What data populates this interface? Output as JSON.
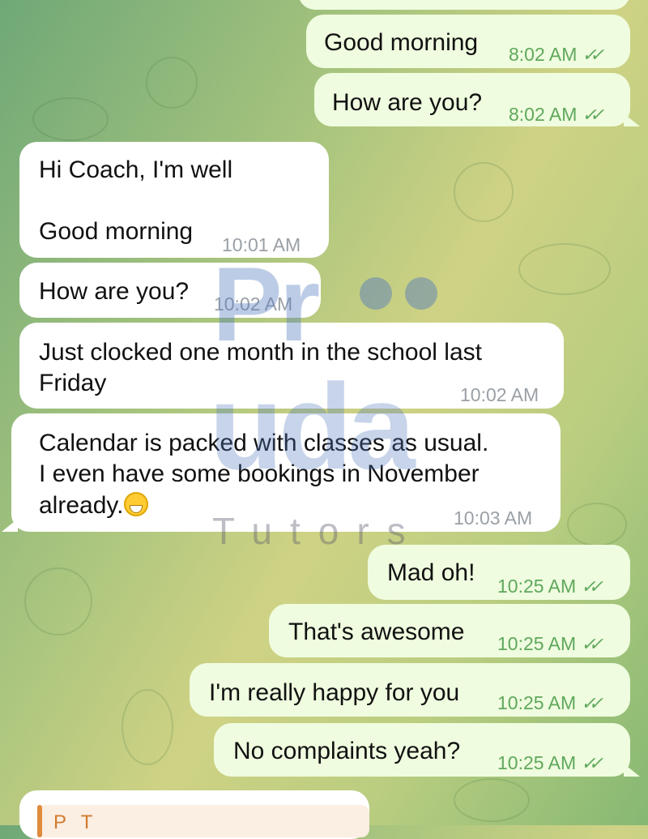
{
  "chat": {
    "messages": [
      {
        "id": "m1",
        "direction": "outgoing",
        "lines": [
          "Good morning"
        ],
        "time": "8:02 AM",
        "read": true
      },
      {
        "id": "m2",
        "direction": "outgoing",
        "lines": [
          "How are you?"
        ],
        "time": "8:02 AM",
        "read": true
      },
      {
        "id": "m3",
        "direction": "incoming",
        "lines": [
          "Hi Coach, I'm well",
          "",
          "Good morning"
        ],
        "time": "10:01 AM"
      },
      {
        "id": "m4",
        "direction": "incoming",
        "lines": [
          "How are you?"
        ],
        "time": "10:02 AM"
      },
      {
        "id": "m5",
        "direction": "incoming",
        "lines": [
          "Just clocked one month in the school last",
          "Friday"
        ],
        "time": "10:02 AM"
      },
      {
        "id": "m6",
        "direction": "incoming",
        "lines": [
          "Calendar is packed with classes as usual.",
          "I even have some bookings in November",
          "already."
        ],
        "emoji": "grinning-face",
        "time": "10:03 AM"
      },
      {
        "id": "m7",
        "direction": "outgoing",
        "lines": [
          "Mad oh!"
        ],
        "time": "10:25 AM",
        "read": true
      },
      {
        "id": "m8",
        "direction": "outgoing",
        "lines": [
          "That's awesome"
        ],
        "time": "10:25 AM",
        "read": true
      },
      {
        "id": "m9",
        "direction": "outgoing",
        "lines": [
          "I'm really happy for you"
        ],
        "time": "10:25 AM",
        "read": true
      },
      {
        "id": "m10",
        "direction": "outgoing",
        "lines": [
          "No complaints yeah?"
        ],
        "time": "10:25 AM",
        "read": true
      }
    ],
    "reply_preview": {
      "name": "P T"
    },
    "read_ticks": "✓✓"
  },
  "watermark": {
    "line1": "Pr",
    "line2": "uda",
    "line3": "Tutors"
  },
  "colors": {
    "outgoing_bubble": "#effcdf",
    "incoming_bubble": "#ffffff",
    "time_outgoing": "#5fa85c",
    "time_incoming": "#9aa0a6",
    "reply_accent": "#e08a3c"
  }
}
